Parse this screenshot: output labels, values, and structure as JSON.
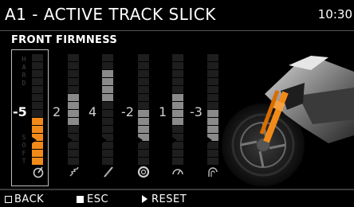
{
  "header": {
    "title": "A1 - ACTIVE TRACK SLICK",
    "clock": "10:30"
  },
  "section": {
    "title": "FRONT FIRMNESS"
  },
  "scale": {
    "hard_letters": [
      "H",
      "A",
      "R",
      "D"
    ],
    "soft_letters": [
      "S",
      "O",
      "F",
      "T"
    ]
  },
  "settings": [
    {
      "value": "-5",
      "level": 0.4,
      "selected": true,
      "icon": "front-suspension-icon"
    },
    {
      "value": "2",
      "level": 0.6,
      "selected": false,
      "icon": "spring-icon"
    },
    {
      "value": "4",
      "level": 0.75,
      "selected": false,
      "icon": "fork-icon"
    },
    {
      "value": "-2",
      "level": 0.45,
      "selected": false,
      "icon": "tyre-icon"
    },
    {
      "value": "1",
      "level": 0.55,
      "selected": false,
      "icon": "gauge-icon"
    },
    {
      "value": "-3",
      "level": 0.42,
      "selected": false,
      "icon": "brake-icon"
    }
  ],
  "colors": {
    "accent": "#f28a1a",
    "segment_on": "#8a8a8a",
    "segment_off": "#1e1e1e"
  },
  "footer": {
    "back_label": "BACK",
    "esc_label": "ESC",
    "reset_label": "RESET"
  }
}
